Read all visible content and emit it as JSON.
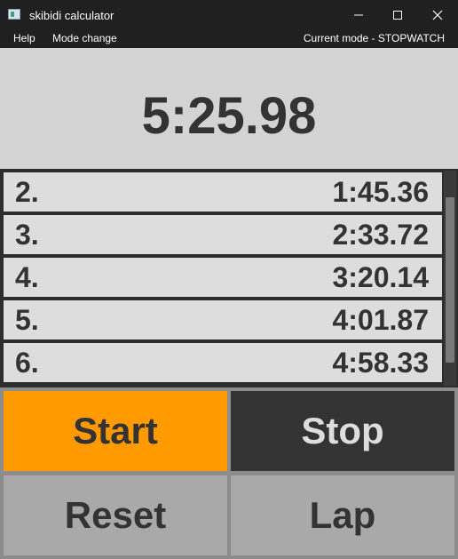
{
  "window": {
    "title": "skibidi calculator"
  },
  "menu": {
    "items": [
      "Help",
      "Mode change"
    ],
    "status": "Current mode - STOPWATCH"
  },
  "display": {
    "time": "5:25.98"
  },
  "laps": [
    {
      "num": "2.",
      "time": "1:45.36"
    },
    {
      "num": "3.",
      "time": "2:33.72"
    },
    {
      "num": "4.",
      "time": "3:20.14"
    },
    {
      "num": "5.",
      "time": "4:01.87"
    },
    {
      "num": "6.",
      "time": "4:58.33"
    }
  ],
  "buttons": {
    "start": "Start",
    "stop": "Stop",
    "reset": "Reset",
    "lap": "Lap"
  },
  "colors": {
    "start_button": "#ff9b00",
    "stop_button": "#333333",
    "secondary_button": "#a9a9a9",
    "display_bg": "#d4d4d4"
  }
}
